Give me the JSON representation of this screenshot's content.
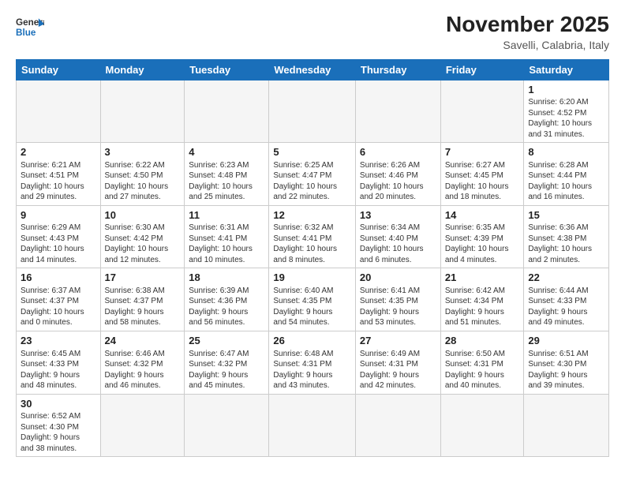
{
  "header": {
    "logo_general": "General",
    "logo_blue": "Blue",
    "month_year": "November 2025",
    "location": "Savelli, Calabria, Italy"
  },
  "weekdays": [
    "Sunday",
    "Monday",
    "Tuesday",
    "Wednesday",
    "Thursday",
    "Friday",
    "Saturday"
  ],
  "weeks": [
    [
      {
        "day": "",
        "info": ""
      },
      {
        "day": "",
        "info": ""
      },
      {
        "day": "",
        "info": ""
      },
      {
        "day": "",
        "info": ""
      },
      {
        "day": "",
        "info": ""
      },
      {
        "day": "",
        "info": ""
      },
      {
        "day": "1",
        "info": "Sunrise: 6:20 AM\nSunset: 4:52 PM\nDaylight: 10 hours\nand 31 minutes."
      }
    ],
    [
      {
        "day": "2",
        "info": "Sunrise: 6:21 AM\nSunset: 4:51 PM\nDaylight: 10 hours\nand 29 minutes."
      },
      {
        "day": "3",
        "info": "Sunrise: 6:22 AM\nSunset: 4:50 PM\nDaylight: 10 hours\nand 27 minutes."
      },
      {
        "day": "4",
        "info": "Sunrise: 6:23 AM\nSunset: 4:48 PM\nDaylight: 10 hours\nand 25 minutes."
      },
      {
        "day": "5",
        "info": "Sunrise: 6:25 AM\nSunset: 4:47 PM\nDaylight: 10 hours\nand 22 minutes."
      },
      {
        "day": "6",
        "info": "Sunrise: 6:26 AM\nSunset: 4:46 PM\nDaylight: 10 hours\nand 20 minutes."
      },
      {
        "day": "7",
        "info": "Sunrise: 6:27 AM\nSunset: 4:45 PM\nDaylight: 10 hours\nand 18 minutes."
      },
      {
        "day": "8",
        "info": "Sunrise: 6:28 AM\nSunset: 4:44 PM\nDaylight: 10 hours\nand 16 minutes."
      }
    ],
    [
      {
        "day": "9",
        "info": "Sunrise: 6:29 AM\nSunset: 4:43 PM\nDaylight: 10 hours\nand 14 minutes."
      },
      {
        "day": "10",
        "info": "Sunrise: 6:30 AM\nSunset: 4:42 PM\nDaylight: 10 hours\nand 12 minutes."
      },
      {
        "day": "11",
        "info": "Sunrise: 6:31 AM\nSunset: 4:41 PM\nDaylight: 10 hours\nand 10 minutes."
      },
      {
        "day": "12",
        "info": "Sunrise: 6:32 AM\nSunset: 4:41 PM\nDaylight: 10 hours\nand 8 minutes."
      },
      {
        "day": "13",
        "info": "Sunrise: 6:34 AM\nSunset: 4:40 PM\nDaylight: 10 hours\nand 6 minutes."
      },
      {
        "day": "14",
        "info": "Sunrise: 6:35 AM\nSunset: 4:39 PM\nDaylight: 10 hours\nand 4 minutes."
      },
      {
        "day": "15",
        "info": "Sunrise: 6:36 AM\nSunset: 4:38 PM\nDaylight: 10 hours\nand 2 minutes."
      }
    ],
    [
      {
        "day": "16",
        "info": "Sunrise: 6:37 AM\nSunset: 4:37 PM\nDaylight: 10 hours\nand 0 minutes."
      },
      {
        "day": "17",
        "info": "Sunrise: 6:38 AM\nSunset: 4:37 PM\nDaylight: 9 hours\nand 58 minutes."
      },
      {
        "day": "18",
        "info": "Sunrise: 6:39 AM\nSunset: 4:36 PM\nDaylight: 9 hours\nand 56 minutes."
      },
      {
        "day": "19",
        "info": "Sunrise: 6:40 AM\nSunset: 4:35 PM\nDaylight: 9 hours\nand 54 minutes."
      },
      {
        "day": "20",
        "info": "Sunrise: 6:41 AM\nSunset: 4:35 PM\nDaylight: 9 hours\nand 53 minutes."
      },
      {
        "day": "21",
        "info": "Sunrise: 6:42 AM\nSunset: 4:34 PM\nDaylight: 9 hours\nand 51 minutes."
      },
      {
        "day": "22",
        "info": "Sunrise: 6:44 AM\nSunset: 4:33 PM\nDaylight: 9 hours\nand 49 minutes."
      }
    ],
    [
      {
        "day": "23",
        "info": "Sunrise: 6:45 AM\nSunset: 4:33 PM\nDaylight: 9 hours\nand 48 minutes."
      },
      {
        "day": "24",
        "info": "Sunrise: 6:46 AM\nSunset: 4:32 PM\nDaylight: 9 hours\nand 46 minutes."
      },
      {
        "day": "25",
        "info": "Sunrise: 6:47 AM\nSunset: 4:32 PM\nDaylight: 9 hours\nand 45 minutes."
      },
      {
        "day": "26",
        "info": "Sunrise: 6:48 AM\nSunset: 4:31 PM\nDaylight: 9 hours\nand 43 minutes."
      },
      {
        "day": "27",
        "info": "Sunrise: 6:49 AM\nSunset: 4:31 PM\nDaylight: 9 hours\nand 42 minutes."
      },
      {
        "day": "28",
        "info": "Sunrise: 6:50 AM\nSunset: 4:31 PM\nDaylight: 9 hours\nand 40 minutes."
      },
      {
        "day": "29",
        "info": "Sunrise: 6:51 AM\nSunset: 4:30 PM\nDaylight: 9 hours\nand 39 minutes."
      }
    ],
    [
      {
        "day": "30",
        "info": "Sunrise: 6:52 AM\nSunset: 4:30 PM\nDaylight: 9 hours\nand 38 minutes."
      },
      {
        "day": "",
        "info": ""
      },
      {
        "day": "",
        "info": ""
      },
      {
        "day": "",
        "info": ""
      },
      {
        "day": "",
        "info": ""
      },
      {
        "day": "",
        "info": ""
      },
      {
        "day": "",
        "info": ""
      }
    ]
  ]
}
